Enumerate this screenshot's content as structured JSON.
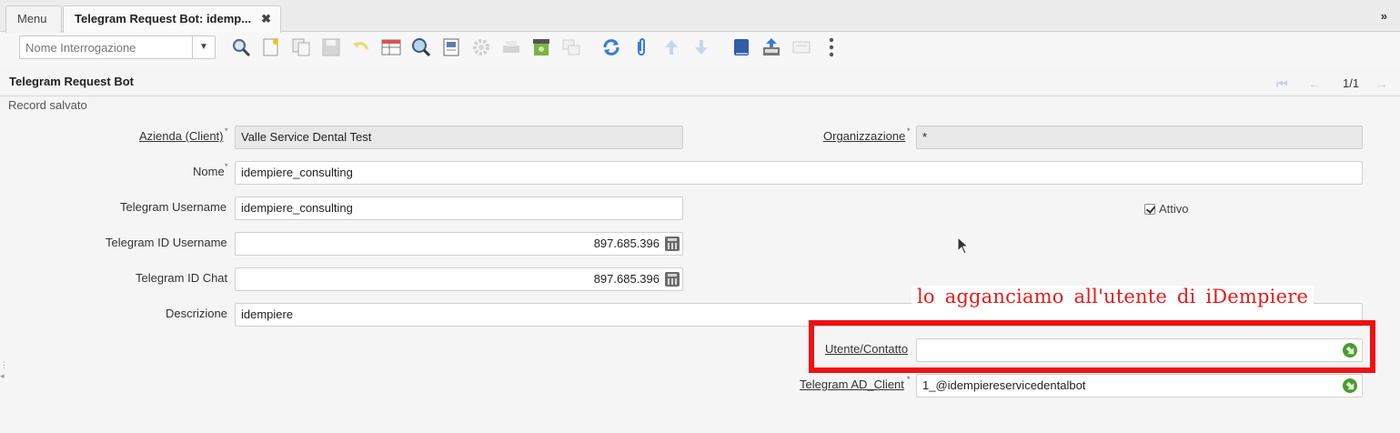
{
  "tabs": [
    {
      "label": "Menu"
    },
    {
      "label": "Telegram Request Bot: idemp...",
      "close": "✖"
    }
  ],
  "collapse_glyph": "»",
  "toolbar": {
    "query_placeholder": "Nome Interrogazione",
    "icons": [
      "search-icon",
      "new-record-icon",
      "copy-icon",
      "save-icon",
      "undo-icon",
      "grid-toggle-icon",
      "find-icon",
      "report-icon",
      "process-gear-icon",
      "print-icon",
      "archive-icon",
      "multi-window-icon",
      "refresh-icon",
      "attachment-icon",
      "up-arrow-icon",
      "down-arrow-icon",
      "book-icon",
      "export-icon",
      "chat-icon",
      "more-icon"
    ]
  },
  "window": {
    "title": "Telegram Request Bot",
    "record_count": "1/1",
    "status": "Record salvato"
  },
  "form": {
    "client": {
      "label": "Azienda (Client)",
      "value": "Valle Service Dental Test"
    },
    "org": {
      "label": "Organizzazione",
      "value": "*"
    },
    "name": {
      "label": "Nome",
      "value": "idempiere_consulting"
    },
    "tg_username": {
      "label": "Telegram Username",
      "value": "idempiere_consulting"
    },
    "active": {
      "label": "Attivo",
      "checked": true
    },
    "tg_id_username": {
      "label": "Telegram ID Username",
      "value": "897.685.396"
    },
    "tg_id_chat": {
      "label": "Telegram ID Chat",
      "value": "897.685.396"
    },
    "description": {
      "label": "Descrizione",
      "value": "idempiere"
    },
    "user_contact": {
      "label": "Utente/Contatto",
      "value": ""
    },
    "tg_ad_client": {
      "label": "Telegram AD_Client",
      "value": "1_@idempiereservicedentalbot"
    }
  },
  "annotation": "lo agganciamo all'utente di iDempiere",
  "colors": {
    "annotation": "#e8191b",
    "highlight": "#ee1212",
    "toolbar_blue": "#3a7bd5"
  }
}
